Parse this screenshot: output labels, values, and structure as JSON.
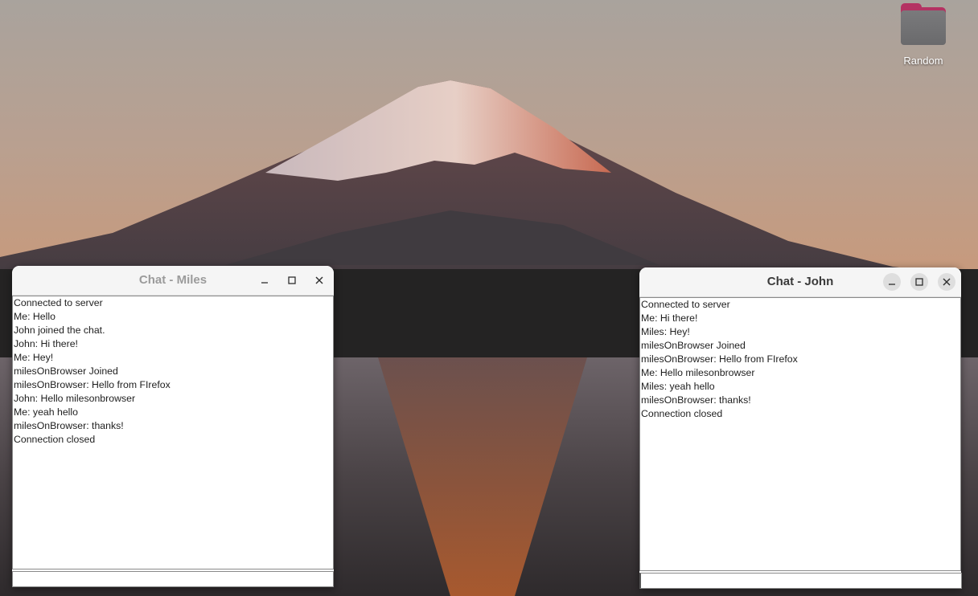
{
  "desktop": {
    "icons": [
      {
        "label": "Random",
        "icon": "folder-icon"
      }
    ]
  },
  "windows": {
    "miles": {
      "title": "Chat - Miles",
      "messages": [
        "Connected to server",
        "Me: Hello",
        "John joined the chat.",
        "John: Hi there!",
        "Me: Hey!",
        "milesOnBrowser Joined",
        "milesOnBrowser: Hello from FIrefox",
        "John: Hello milesonbrowser",
        "Me: yeah hello",
        "milesOnBrowser: thanks!",
        "Connection closed"
      ],
      "input_value": ""
    },
    "john": {
      "title": "Chat - John",
      "messages": [
        "Connected to server",
        "Me: Hi there!",
        "Miles: Hey!",
        "milesOnBrowser Joined",
        "milesOnBrowser: Hello from FIrefox",
        "Me: Hello milesonbrowser",
        "Miles: yeah hello",
        "milesOnBrowser: thanks!",
        "Connection closed"
      ],
      "input_value": ""
    }
  },
  "window_controls": {
    "minimize": "minimize-icon",
    "maximize": "maximize-icon",
    "close": "close-icon"
  }
}
